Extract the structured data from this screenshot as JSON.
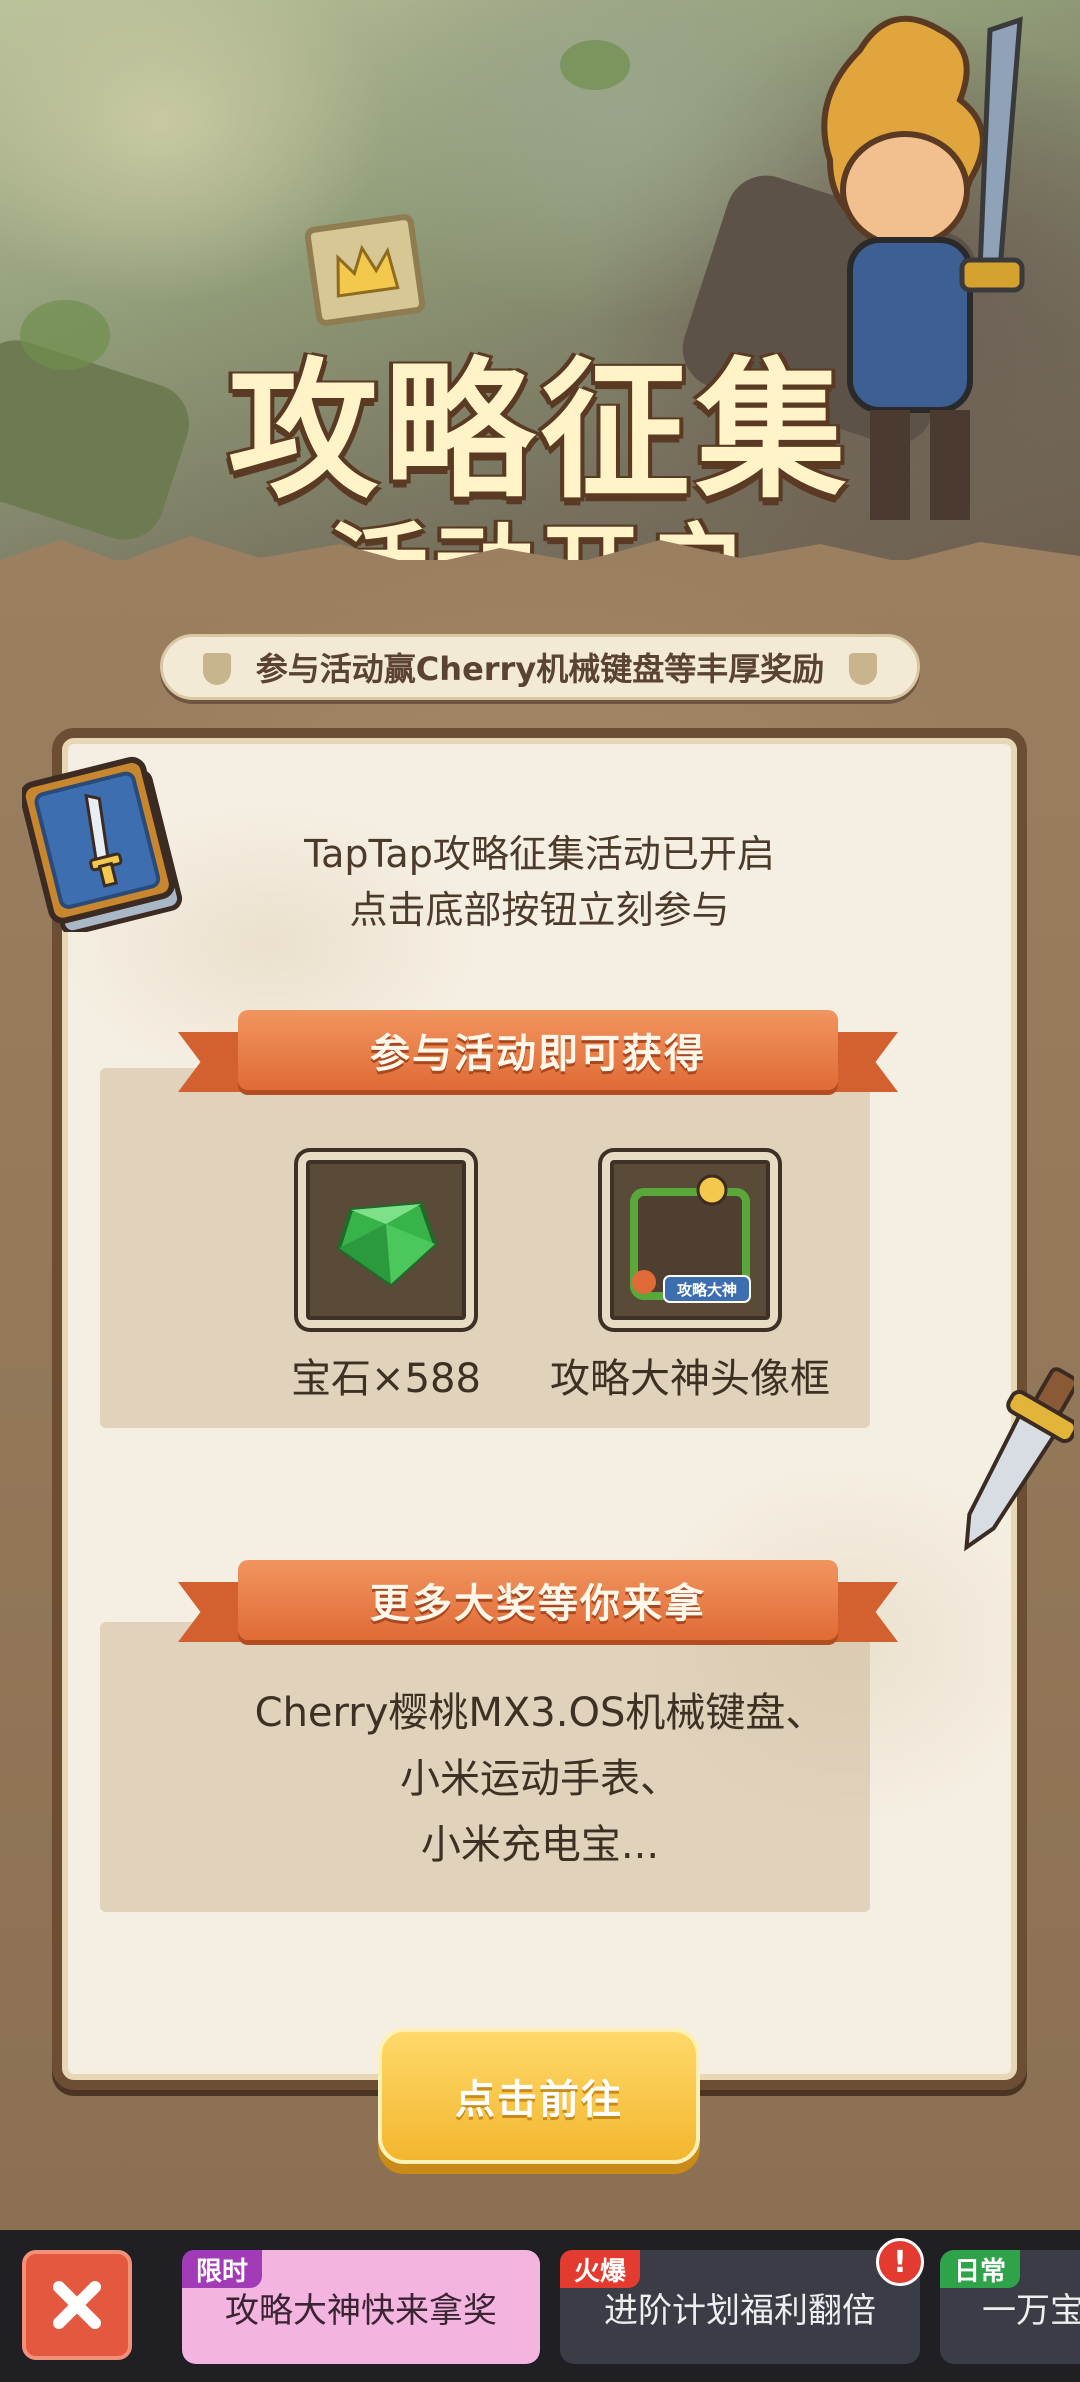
{
  "hero": {
    "title": "攻略征集",
    "subtitle": "活动开启",
    "tagline": "参与活动赢Cherry机械键盘等丰厚奖励"
  },
  "card": {
    "intro_line1": "TapTap攻略征集活动已开启",
    "intro_line2": "点击底部按钮立刻参与",
    "section1_title": "参与活动即可获得",
    "rewards": [
      {
        "name": "宝石×588",
        "icon": "gem-icon"
      },
      {
        "name": "攻略大神头像框",
        "icon": "avatar-frame-icon",
        "frame_label": "攻略大神"
      }
    ],
    "section2_title": "更多大奖等你来拿",
    "prizes": [
      "Cherry樱桃MX3.OS机械键盘、",
      "小米运动手表、",
      "小米充电宝..."
    ],
    "cta_label": "点击前往"
  },
  "bottom_bar": {
    "close_icon": "close-icon",
    "tabs": [
      {
        "tag": "限时",
        "label": "攻略大神快来拿奖",
        "tag_color": "#a23bb7"
      },
      {
        "tag": "火爆",
        "label": "进阶计划福利翻倍",
        "tag_color": "#e33b2f",
        "alert": "!"
      },
      {
        "tag": "日常",
        "label": "一万宝",
        "tag_color": "#2fa34a"
      }
    ]
  }
}
